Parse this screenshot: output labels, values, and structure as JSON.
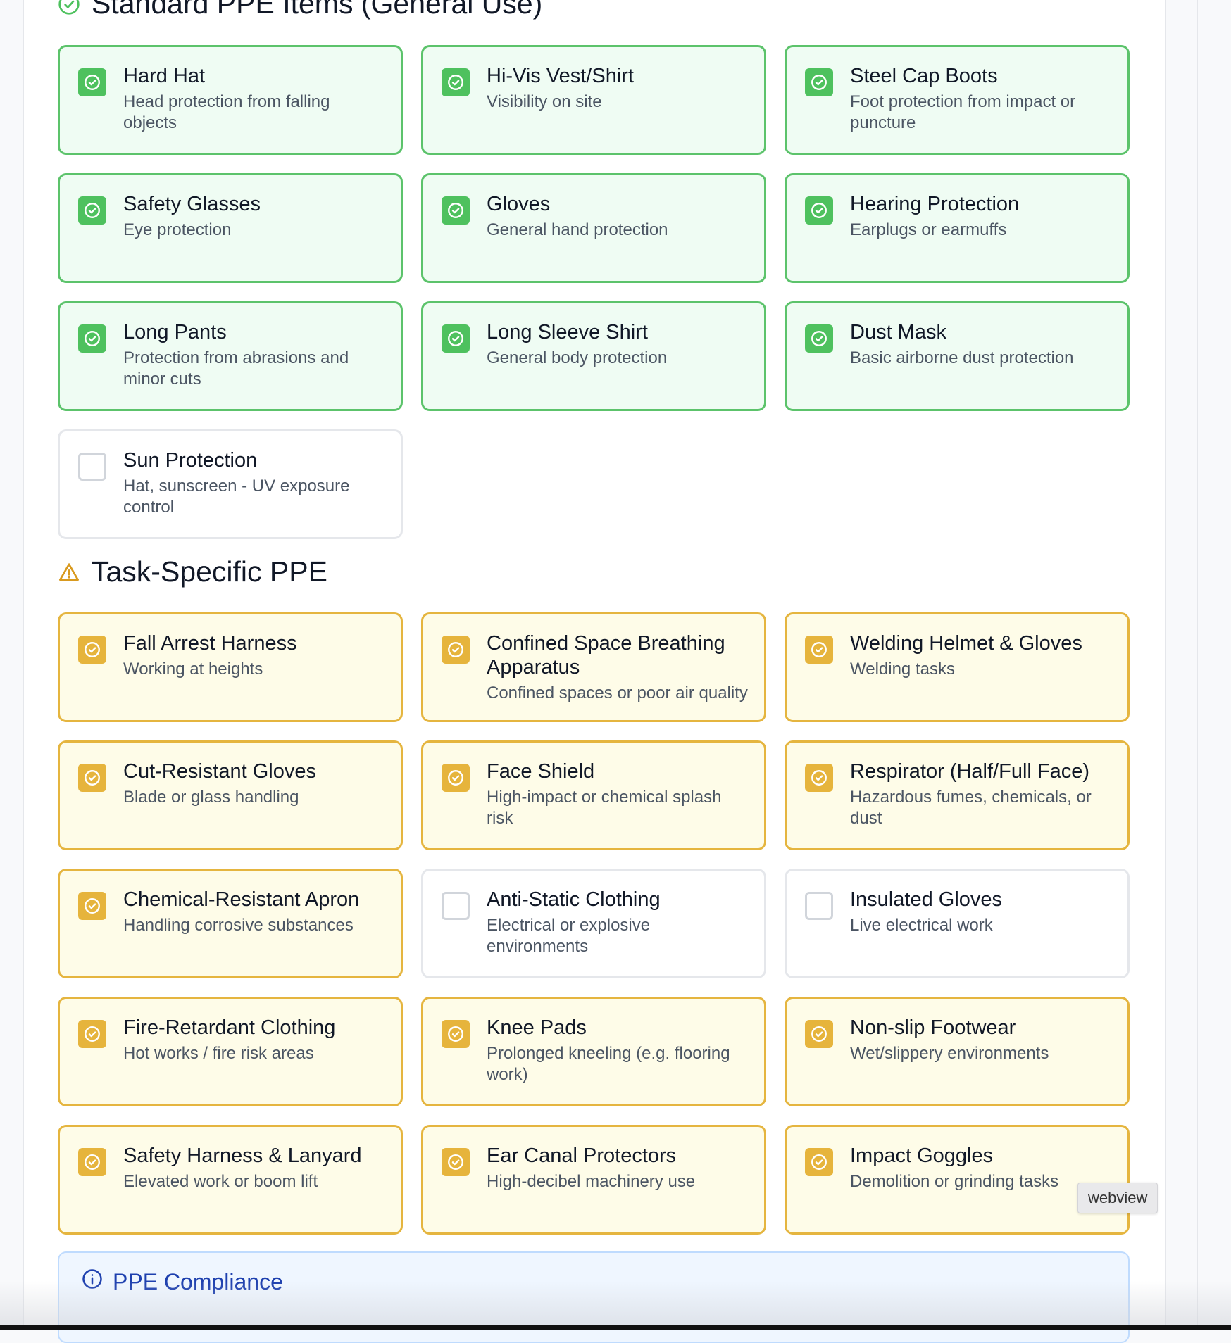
{
  "sections": {
    "standard": {
      "title": "Standard PPE Items (General Use)",
      "icon": "check-circle-icon"
    },
    "task": {
      "title": "Task-Specific PPE",
      "icon": "warning-triangle-icon"
    }
  },
  "standard_items": [
    {
      "title": "Hard Hat",
      "desc": "Head protection from falling objects",
      "checked": true
    },
    {
      "title": "Hi-Vis Vest/Shirt",
      "desc": "Visibility on site",
      "checked": true
    },
    {
      "title": "Steel Cap Boots",
      "desc": "Foot protection from impact or puncture",
      "checked": true
    },
    {
      "title": "Safety Glasses",
      "desc": "Eye protection",
      "checked": true
    },
    {
      "title": "Gloves",
      "desc": "General hand protection",
      "checked": true
    },
    {
      "title": "Hearing Protection",
      "desc": "Earplugs or earmuffs",
      "checked": true
    },
    {
      "title": "Long Pants",
      "desc": "Protection from abrasions and minor cuts",
      "checked": true
    },
    {
      "title": "Long Sleeve Shirt",
      "desc": "General body protection",
      "checked": true
    },
    {
      "title": "Dust Mask",
      "desc": "Basic airborne dust protection",
      "checked": true
    },
    {
      "title": "Sun Protection",
      "desc": "Hat, sunscreen - UV exposure control",
      "checked": false
    }
  ],
  "task_items": [
    {
      "title": "Fall Arrest Harness",
      "desc": "Working at heights",
      "checked": true
    },
    {
      "title": "Confined Space Breathing Apparatus",
      "desc": "Confined spaces or poor air quality",
      "checked": true
    },
    {
      "title": "Welding Helmet & Gloves",
      "desc": "Welding tasks",
      "checked": true
    },
    {
      "title": "Cut-Resistant Gloves",
      "desc": "Blade or glass handling",
      "checked": true
    },
    {
      "title": "Face Shield",
      "desc": "High-impact or chemical splash risk",
      "checked": true
    },
    {
      "title": "Respirator (Half/Full Face)",
      "desc": "Hazardous fumes, chemicals, or dust",
      "checked": true
    },
    {
      "title": "Chemical-Resistant Apron",
      "desc": "Handling corrosive substances",
      "checked": true
    },
    {
      "title": "Anti-Static Clothing",
      "desc": "Electrical or explosive environments",
      "checked": false
    },
    {
      "title": "Insulated Gloves",
      "desc": "Live electrical work",
      "checked": false
    },
    {
      "title": "Fire-Retardant Clothing",
      "desc": "Hot works / fire risk areas",
      "checked": true
    },
    {
      "title": "Knee Pads",
      "desc": "Prolonged kneeling (e.g. flooring work)",
      "checked": true
    },
    {
      "title": "Non-slip Footwear",
      "desc": "Wet/slippery environments",
      "checked": true
    },
    {
      "title": "Safety Harness & Lanyard",
      "desc": "Elevated work or boom lift",
      "checked": true
    },
    {
      "title": "Ear Canal Protectors",
      "desc": "High-decibel machinery use",
      "checked": true
    },
    {
      "title": "Impact Goggles",
      "desc": "Demolition or grinding tasks",
      "checked": true
    }
  ],
  "compliance": {
    "title": "PPE Compliance",
    "icon": "info-icon"
  },
  "tooltip": {
    "text": "webview"
  },
  "colors": {
    "standard_checked_border": "#5cc36b",
    "standard_checked_bg": "#effcf3",
    "task_checked_border": "#e5b53f",
    "task_checked_bg": "#fefce8",
    "unchecked_border": "#e5e7eb",
    "compliance_accent": "#1e40af"
  }
}
